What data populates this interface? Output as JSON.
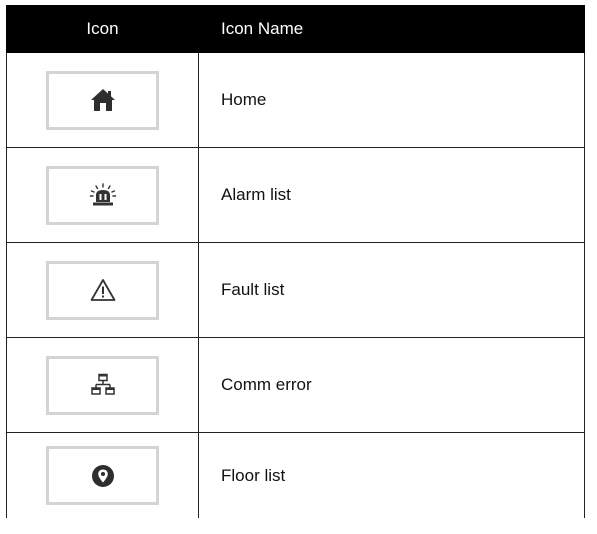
{
  "table": {
    "headers": {
      "icon": "Icon",
      "name": "Icon Name"
    },
    "rows": [
      {
        "icon": "home-icon",
        "name": "Home"
      },
      {
        "icon": "alarm-beacon-icon",
        "name": "Alarm list"
      },
      {
        "icon": "warning-triangle-icon",
        "name": "Fault list"
      },
      {
        "icon": "network-icon",
        "name": "Comm error"
      },
      {
        "icon": "location-pin-icon",
        "name": "Floor list"
      }
    ]
  },
  "colors": {
    "header_bg": "#000000",
    "header_text": "#ffffff",
    "icon_frame": "#d4d4d4",
    "icon_fill": "#333333"
  }
}
